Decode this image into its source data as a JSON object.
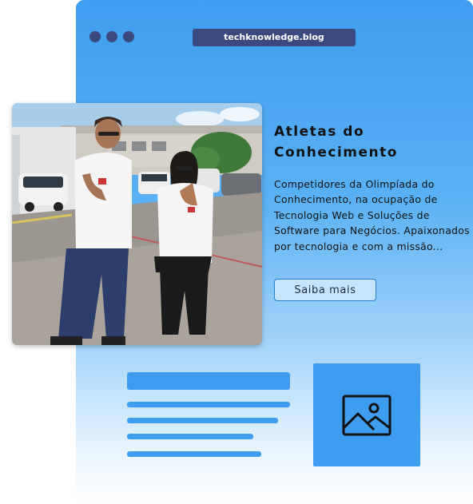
{
  "browser": {
    "url": "techknowledge.blog",
    "window_dots": [
      "dot-1",
      "dot-2",
      "dot-3"
    ]
  },
  "article": {
    "title": "Atletas do Conhecimento",
    "description": "Competidores da Olimpíada do Conhecimento, na ocupação de Tecnologia Web e Soluções de Software para Negócios. Apaixonados por tecnologia e com a missão...",
    "cta_label": "Saiba mais",
    "photo_icon": "photo-of-two-students"
  },
  "placeholder": {
    "image_icon": "image-placeholder-icon"
  },
  "colors": {
    "accent": "#3f9df0",
    "dark_navy": "#3a4a7e"
  }
}
